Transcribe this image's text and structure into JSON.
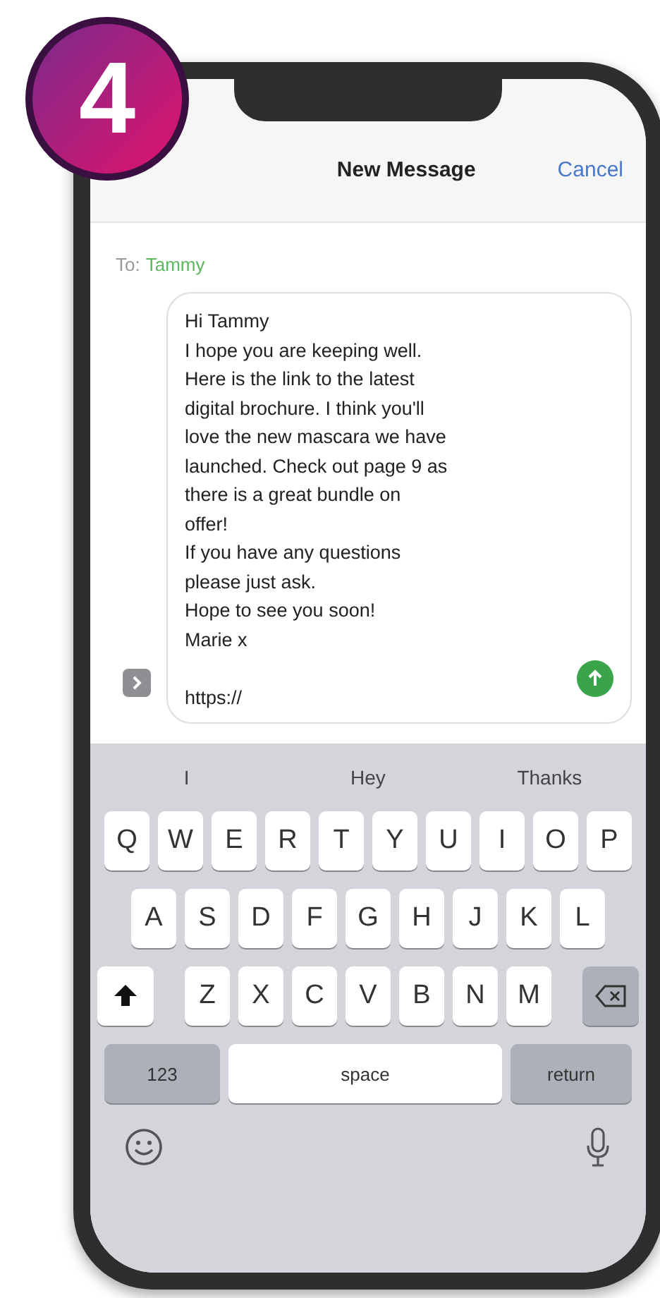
{
  "step_badge": "4",
  "header": {
    "title": "New Message",
    "cancel": "Cancel"
  },
  "recipient": {
    "label": "To:",
    "name": "Tammy"
  },
  "message": {
    "lines": [
      "Hi Tammy",
      "I hope you are keeping well.",
      "Here is the link to the latest",
      "digital brochure. I think you'll",
      "love the new mascara we have",
      "launched. Check out page 9 as",
      "there is a great bundle on",
      "offer!",
      "If you have any questions",
      "please just ask.",
      "Hope to see you soon!",
      "Marie x"
    ],
    "link": "https://"
  },
  "suggestions": [
    "I",
    "Hey",
    "Thanks"
  ],
  "keyboard": {
    "rows": [
      [
        "Q",
        "W",
        "E",
        "R",
        "T",
        "Y",
        "U",
        "I",
        "O",
        "P"
      ],
      [
        "A",
        "S",
        "D",
        "F",
        "G",
        "H",
        "J",
        "K",
        "L"
      ],
      [
        "Z",
        "X",
        "C",
        "V",
        "B",
        "N",
        "M"
      ]
    ],
    "numbers": "123",
    "space": "space",
    "return": "return"
  }
}
